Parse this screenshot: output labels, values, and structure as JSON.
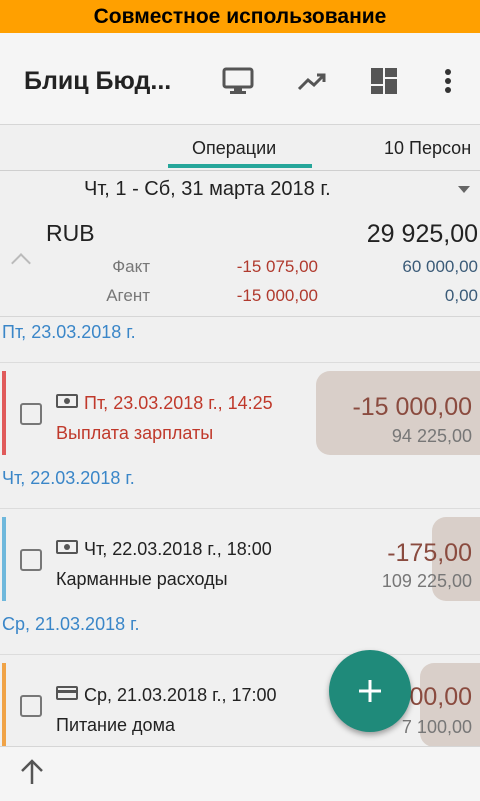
{
  "banner": {
    "text": "Совместное использование"
  },
  "appbar": {
    "title": "Блиц Бюд...",
    "icons": [
      "monitor-icon",
      "trending-up-icon",
      "dashboard-icon",
      "more-vert-icon"
    ]
  },
  "tabs": [
    {
      "label": "Операции",
      "active": true
    },
    {
      "label": "10 Персон"
    }
  ],
  "period": {
    "text": "Чт, 1 - Сб, 31 марта 2018 г."
  },
  "summary": {
    "currency": "RUB",
    "total": "29 925,00",
    "rows": [
      {
        "label": "Факт",
        "negative": "-15 075,00",
        "positive": "60 000,00"
      },
      {
        "label": "Агент",
        "negative": "-15 000,00",
        "positive": "0,00"
      }
    ]
  },
  "groups": [
    {
      "date": "Пт, 23.03.2018 г.",
      "item": {
        "datetime": "Пт, 23.03.2018 г., 14:25",
        "description": "Выплата зарплаты",
        "amount": "-15 000,00",
        "balance": "94 225,00",
        "icon": "cash-icon",
        "stripe_color": "#e05a5a"
      }
    },
    {
      "date": "Чт, 22.03.2018 г.",
      "item": {
        "datetime": "Чт, 22.03.2018 г., 18:00",
        "description": "Карманные расходы",
        "amount": "-175,00",
        "balance": "109 225,00",
        "icon": "cash-icon",
        "stripe_color": "#6fb8dc"
      }
    },
    {
      "date": "Ср, 21.03.2018 г.",
      "item": {
        "datetime": "Ср, 21.03.2018 г., 17:00",
        "description": "Питание дома",
        "amount": "00,00",
        "balance": "7 100,00",
        "icon": "card-icon",
        "stripe_color": "#f0a347"
      }
    }
  ],
  "colors": {
    "accent": "#26a69a",
    "fab": "#1f8a7a",
    "banner": "#ffa000",
    "negative": "#b03a2e",
    "positive": "#3b5b78",
    "date_header": "#3a86c8"
  }
}
